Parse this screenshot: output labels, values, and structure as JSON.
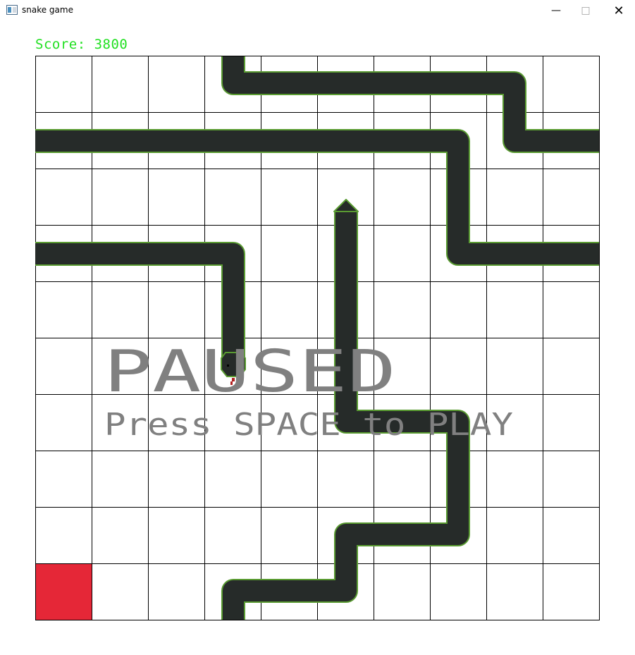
{
  "window": {
    "title": "snake game",
    "minimize_glyph": "—",
    "maximize_glyph": "□",
    "close_glyph": "✕"
  },
  "hud": {
    "score_text": "Score: 3800"
  },
  "overlay": {
    "title": "PAUSED",
    "subtitle": "Press SPACE to PLAY"
  },
  "colors": {
    "score": "#22e022",
    "snake_body": "#262b29",
    "snake_outline": "#5a9b32",
    "food": "#e52737",
    "grid": "#000000",
    "overlay_text": "#808080",
    "tongue": "#b02020"
  },
  "icons": [
    "app-icon",
    "minimize-icon",
    "maximize-icon",
    "close-icon"
  ]
}
